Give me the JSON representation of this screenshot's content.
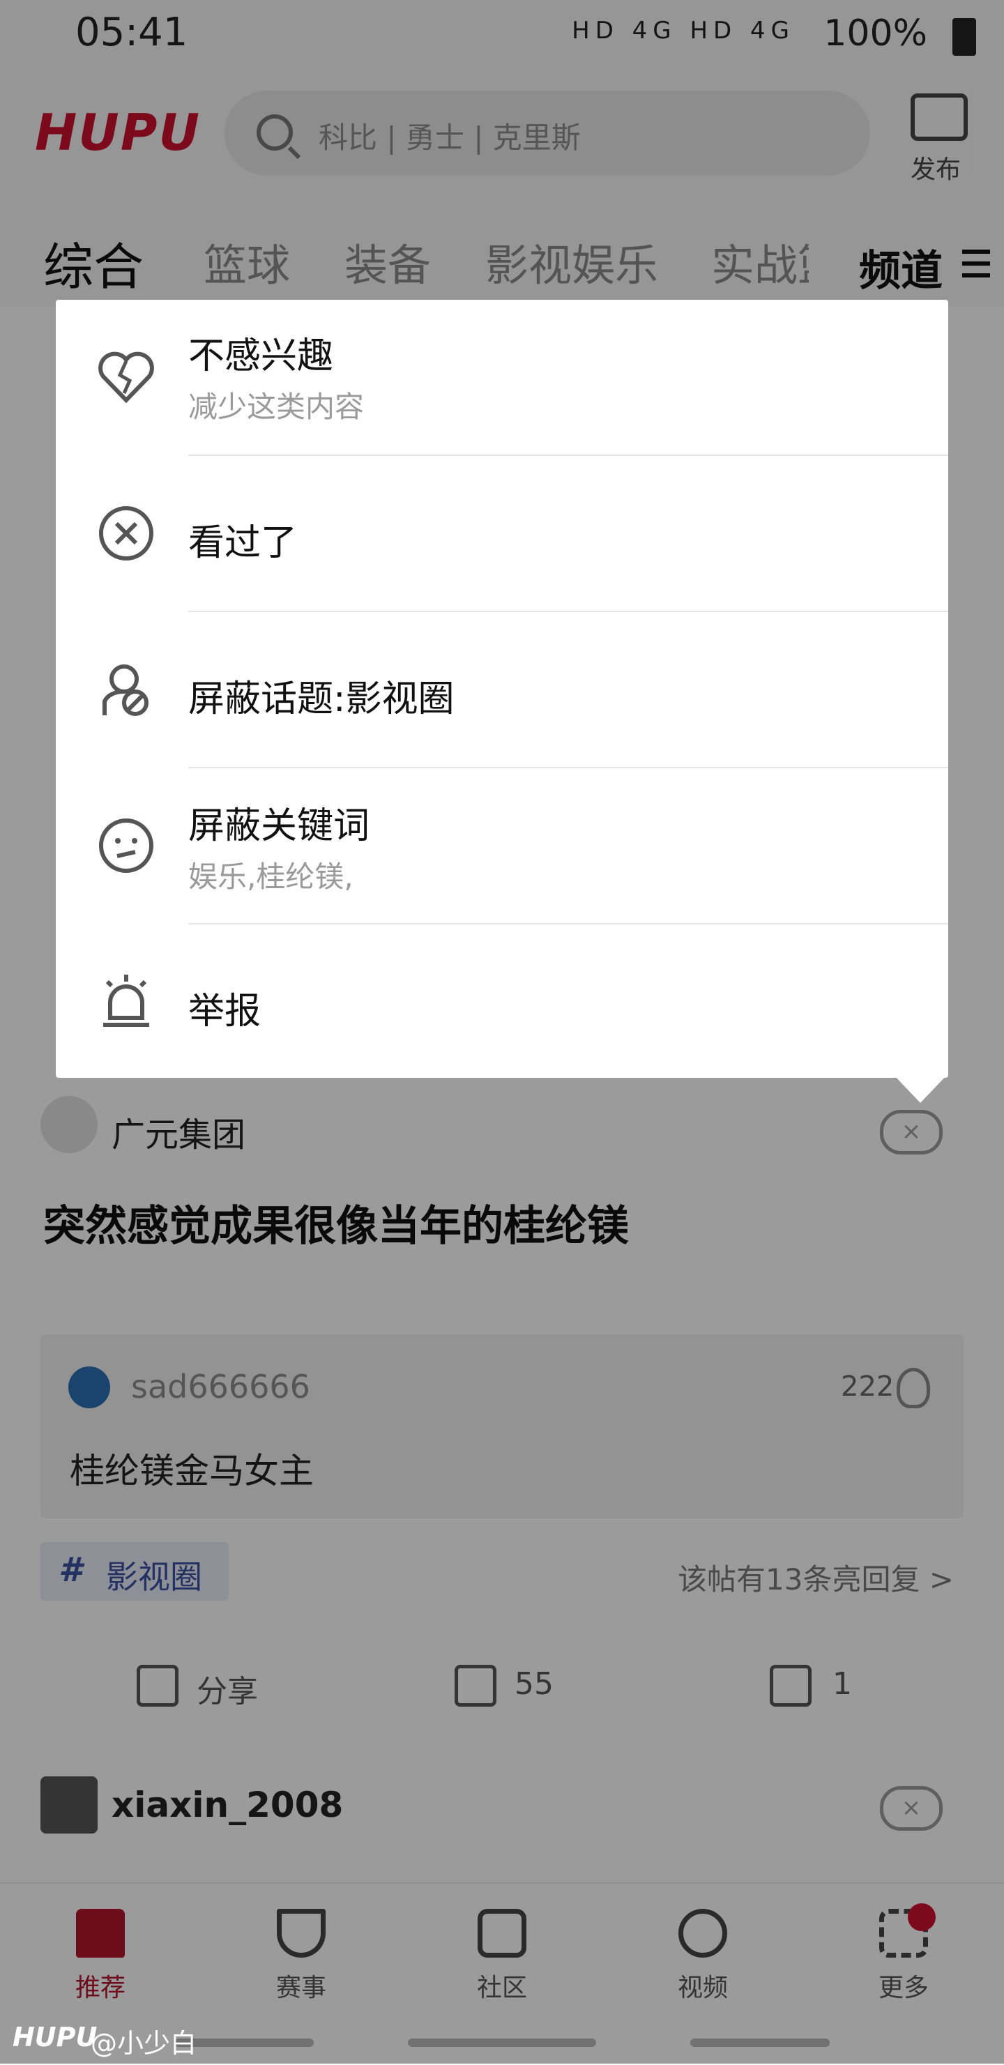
{
  "status_bar": {
    "time": "05:41",
    "network": "HD 4G HD 4G",
    "battery": "100%"
  },
  "header": {
    "logo": "HUPU",
    "search_placeholder": "科比 | 勇士 | 克里斯",
    "publish_label": "发布"
  },
  "tabs": {
    "items": [
      "综合",
      "篮球",
      "装备",
      "影视娱乐",
      "实战篮"
    ],
    "active_index": 0,
    "channel_label": "频道"
  },
  "menu": {
    "items": [
      {
        "label": "不感兴趣",
        "sub": "减少这类内容",
        "icon": "broken-heart-icon"
      },
      {
        "label": "看过了",
        "sub": "",
        "icon": "x-circle-icon"
      },
      {
        "label": "屏蔽话题:影视圈",
        "sub": "",
        "icon": "block-topic-icon"
      },
      {
        "label": "屏蔽关键词",
        "sub": "娱乐,桂纶镁,",
        "icon": "confused-face-icon"
      },
      {
        "label": "举报",
        "sub": "",
        "icon": "alarm-siren-icon"
      }
    ]
  },
  "post": {
    "author": "广元集团",
    "title": "突然感觉成果很像当年的桂纶镁",
    "quote_user": "sad666666",
    "quote_likes": "222",
    "quote_text": "桂纶镁金马女主",
    "topic_hash": "#",
    "topic": "影视圈",
    "replies_hint": "该帖有13条亮回复 >",
    "share_label": "分享",
    "comments": "55",
    "likes": "1",
    "close_symbol": "×"
  },
  "next_post": {
    "author": "xiaxin_2008"
  },
  "bottom_nav": {
    "items": [
      "推荐",
      "赛事",
      "社区",
      "视频",
      "更多"
    ],
    "active_index": 0
  },
  "watermark": {
    "logo": "HUPU",
    "text": "@小少白"
  },
  "colors": {
    "brand": "#c8102e",
    "topic": "#3a4fa0"
  }
}
